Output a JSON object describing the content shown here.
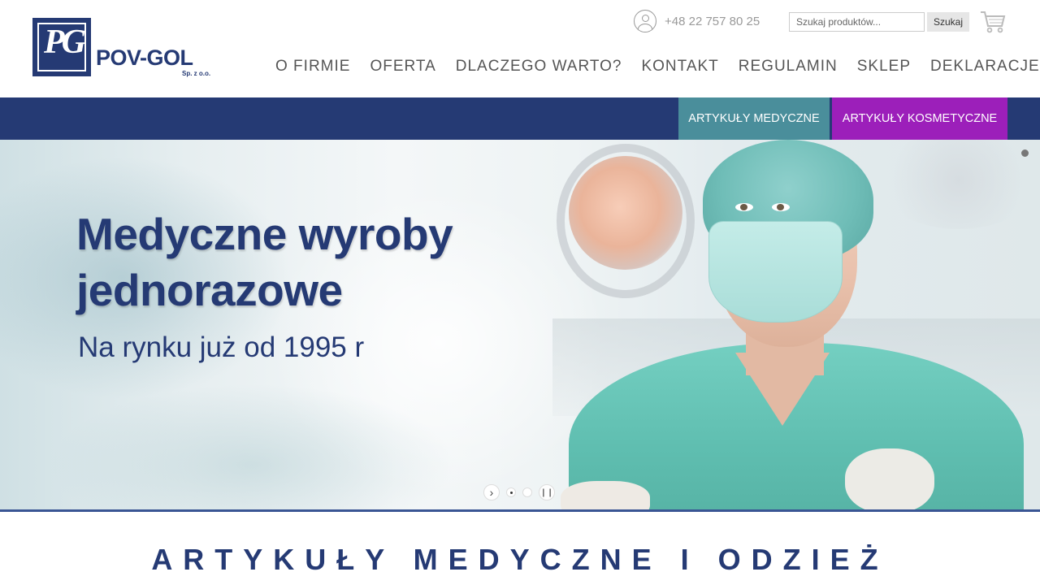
{
  "brand": {
    "logo_letters": "PG",
    "name": "POV-GOL",
    "suffix": "Sp. z o.o.",
    "color": "#253a74"
  },
  "header": {
    "phone": "+48 22 757 80 25",
    "search": {
      "placeholder": "Szukaj produktów...",
      "button_label": "Szukaj"
    },
    "icons": [
      "user-icon",
      "cart-icon"
    ]
  },
  "nav": {
    "items": [
      {
        "label": "O FIRMIE"
      },
      {
        "label": "OFERTA"
      },
      {
        "label": "DLACZEGO WARTO?"
      },
      {
        "label": "KONTAKT"
      },
      {
        "label": "REGULAMIN"
      },
      {
        "label": "SKLEP"
      },
      {
        "label": "DEKLARACJE"
      }
    ]
  },
  "categories": {
    "medical": {
      "label": "ARTYKUŁY MEDYCZNE",
      "color": "#4a8e9b"
    },
    "cosmetic": {
      "label": "ARTYKUŁY KOSMETYCZNE",
      "color": "#9c1fba"
    }
  },
  "hero": {
    "title_line1": "Medyczne wyroby",
    "title_line2": "jednorazowe",
    "subtitle": "Na rynku już od 1995 r",
    "slides": 2,
    "active_slide": 1
  },
  "section": {
    "title": "ARTYKUŁY MEDYCZNE I ODZIEŻ"
  },
  "colors": {
    "navy": "#253a74",
    "teal": "#4a8e9b",
    "purple": "#9c1fba"
  }
}
